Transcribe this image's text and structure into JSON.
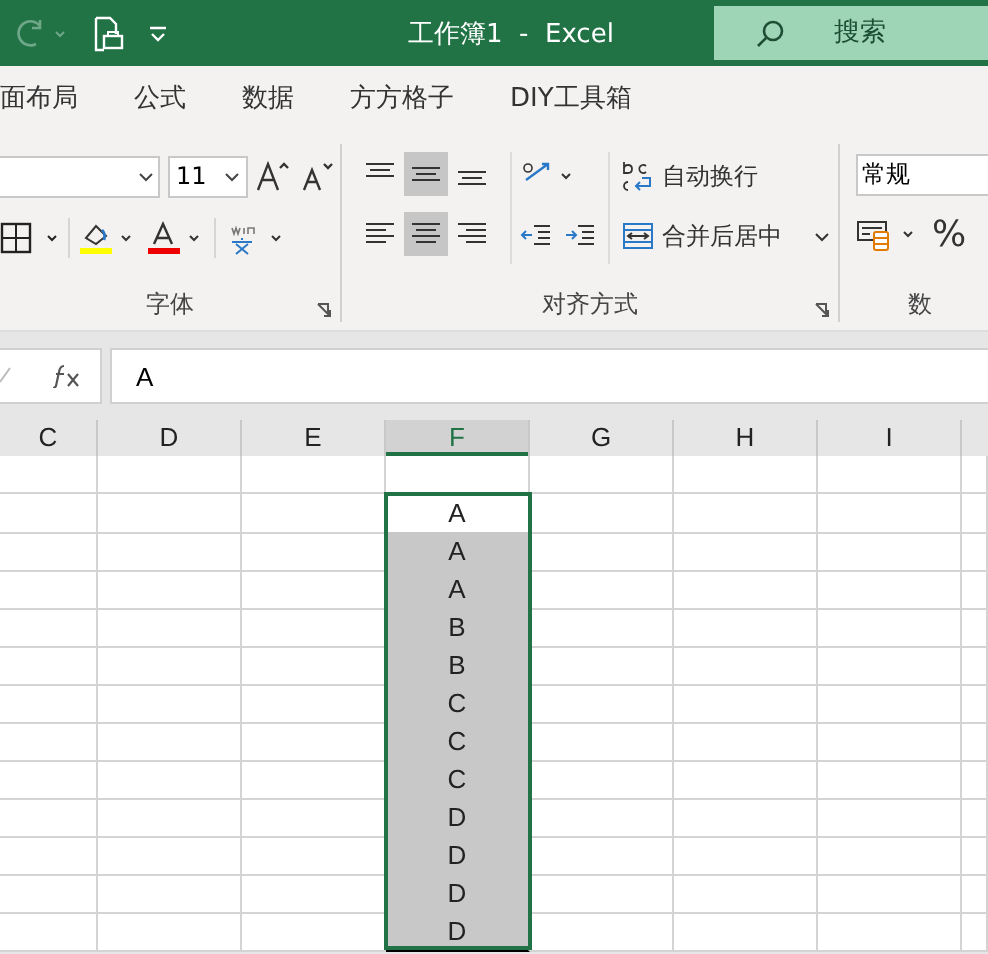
{
  "title_bar": {
    "title": "工作簿1  -  Excel",
    "search": {
      "placeholder": "搜索"
    }
  },
  "tabs": [
    {
      "label": "面布局",
      "selected": false
    },
    {
      "label": "公式",
      "selected": false
    },
    {
      "label": "数据",
      "selected": false
    },
    {
      "label": "方方格子",
      "selected": false
    },
    {
      "label": "DIY工具箱",
      "selected": false
    }
  ],
  "ribbon": {
    "font": {
      "label": "字体",
      "font_size": "11"
    },
    "alignment": {
      "label": "对齐方式",
      "vertical": [
        {
          "selected": false
        },
        {
          "selected": true
        },
        {
          "selected": false
        }
      ],
      "horizontal": [
        {
          "selected": false
        },
        {
          "selected": true
        },
        {
          "selected": false
        }
      ],
      "wrap_text": "自动换行",
      "merge_center": "合并后居中"
    },
    "number": {
      "label": "数",
      "format": "常规",
      "percent": "%"
    }
  },
  "formula_bar": {
    "value": "A"
  },
  "sheet": {
    "columns": [
      {
        "label": "C",
        "selected": false
      },
      {
        "label": "D",
        "selected": false
      },
      {
        "label": "E",
        "selected": false
      },
      {
        "label": "F",
        "selected": true
      },
      {
        "label": "G",
        "selected": false
      },
      {
        "label": "H",
        "selected": false
      },
      {
        "label": "I",
        "selected": false
      }
    ],
    "rows": [
      {
        "value": "",
        "selected": false,
        "shaded": false
      },
      {
        "value": "A",
        "selected": true,
        "shaded": false
      },
      {
        "value": "A",
        "selected": true,
        "shaded": true
      },
      {
        "value": "A",
        "selected": true,
        "shaded": true
      },
      {
        "value": "B",
        "selected": true,
        "shaded": true
      },
      {
        "value": "B",
        "selected": true,
        "shaded": true
      },
      {
        "value": "C",
        "selected": true,
        "shaded": true
      },
      {
        "value": "C",
        "selected": true,
        "shaded": true
      },
      {
        "value": "C",
        "selected": true,
        "shaded": true
      },
      {
        "value": "D",
        "selected": true,
        "shaded": true
      },
      {
        "value": "D",
        "selected": true,
        "shaded": true
      },
      {
        "value": "D",
        "selected": true,
        "shaded": true
      },
      {
        "value": "D",
        "selected": true,
        "shaded": true
      }
    ]
  }
}
